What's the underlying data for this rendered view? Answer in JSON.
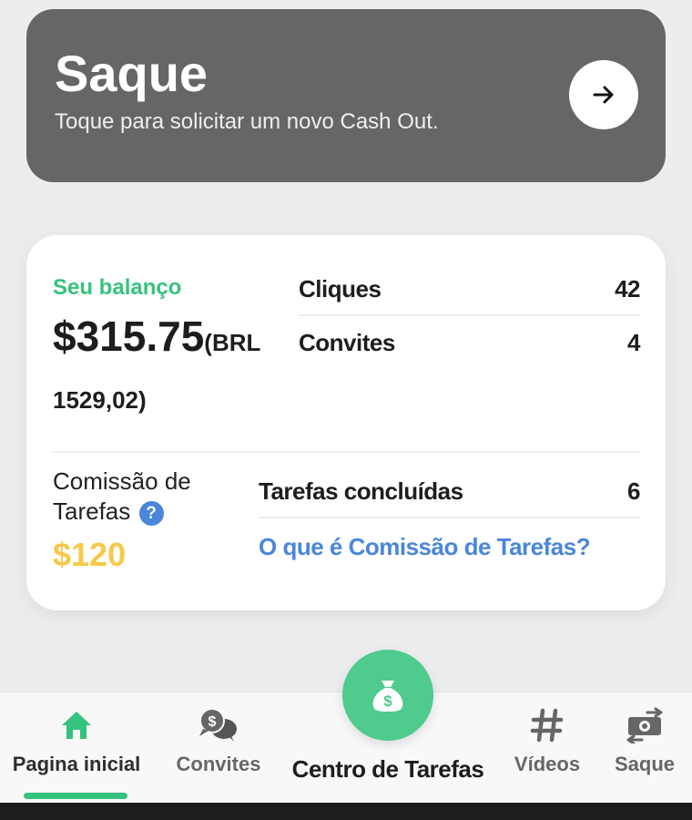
{
  "saque_card": {
    "title": "Saque",
    "subtitle": "Toque para solicitar um novo Cash Out.",
    "arrow_icon": "arrow-right-icon"
  },
  "balance": {
    "label": "Seu balanço",
    "amount": "$315.75",
    "brl_open": "(BRL",
    "brl_value": "1529,02)",
    "stats": [
      {
        "label": "Cliques",
        "value": "42"
      },
      {
        "label": "Convites",
        "value": "4"
      }
    ]
  },
  "commission": {
    "label_line1": "Comissão de",
    "label_line2": "Tarefas",
    "help": "?",
    "amount": "$120",
    "tasks_label": "Tarefas concluídas",
    "tasks_value": "6",
    "link": "O que é Comissão de Tarefas?"
  },
  "nav": {
    "items": [
      {
        "label": "Pagina inicial",
        "icon": "home-icon",
        "active": true
      },
      {
        "label": "Convites",
        "icon": "chat-dollar-icon"
      },
      {
        "label": "Centro de Tarefas",
        "icon": "money-bag-icon"
      },
      {
        "label": "Vídeos",
        "icon": "hash-icon"
      },
      {
        "label": "Saque",
        "icon": "cash-exchange-icon"
      }
    ]
  },
  "colors": {
    "accent_green": "#35c27e",
    "fab_green": "#4ecb8d",
    "link_blue": "#4a86d9",
    "commission_yellow": "#f6c94a",
    "saque_card": "#666666"
  }
}
